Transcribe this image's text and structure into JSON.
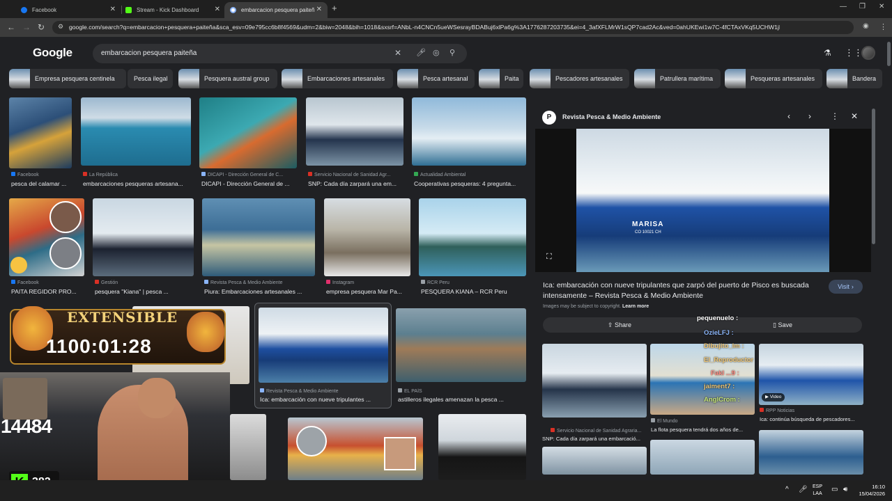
{
  "tabs": [
    {
      "label": "Facebook",
      "color": "#1877f2"
    },
    {
      "label": "Stream - Kick Dashboard",
      "color": "#53fc18"
    },
    {
      "label": "embarcacion pesquera paiteñ",
      "color": "#8ab4f8"
    }
  ],
  "new_tab": "+",
  "url": "google.com/search?q=embarcacion+pesquera+paiteña&sca_esv=09e795cc6b8f4569&udm=2&biw=2048&bih=1018&sxsrf=ANbL-n4CNCn5ueWSesrayBDABuj6xlPa6g%3A1776287203735&ei=4_3afXFLMrW1sQP7cad2Ac&ved=0ahUKEwi1w7C-4fCTAxVKq5UCHW1jB3s...",
  "google": {
    "logo": "Google",
    "query": "embarcacion pesquera paiteña"
  },
  "chips": [
    "Empresa pesquera centinela",
    "Pesca ilegal",
    "Pesquera austral group",
    "Embarcaciones artesanales",
    "Pesca artesanal",
    "Paita",
    "Pescadores artesanales",
    "Patrullera marítima",
    "Pesqueras artesanales",
    "Bandera"
  ],
  "results": {
    "row1": [
      {
        "source": "Facebook",
        "title": "pesca del calamar ...",
        "fav": "#1877f2"
      },
      {
        "source": "La República",
        "title": "embarcaciones pesqueras artesana...",
        "fav": "#d93025"
      },
      {
        "source": "DICAPI - Dirección General de C...",
        "title": "DICAPI - Dirección General de ...",
        "fav": "#8ab4f8"
      },
      {
        "source": "Servicio Nacional de Sanidad Agr...",
        "title": "SNP: Cada día zarpará una em...",
        "fav": "#d93025"
      },
      {
        "source": "Actualidad Ambiental",
        "title": "Cooperativas pesqueras: 4 pregunta...",
        "fav": "#34a853"
      }
    ],
    "row2": [
      {
        "source": "Facebook",
        "title": "PAITA REGIDOR PRO...",
        "fav": "#1877f2"
      },
      {
        "source": "Gestión",
        "title": "pesquera \"Kiana\" | pesca ...",
        "fav": "#d93025"
      },
      {
        "source": "Revista Pesca & Medio Ambiente",
        "title": "Piura: Embarcaciones artesanales ...",
        "fav": "#8ab4f8"
      },
      {
        "source": "Instagram",
        "title": "empresa pesquera Mar Pa...",
        "fav": "#e1306c"
      },
      {
        "source": "RCR Peru",
        "title": "PESQUERA KIANA – RCR Peru",
        "fav": "#9aa0a6"
      }
    ],
    "row3": [
      {
        "source": "Revista Pesca & Medio Ambiente",
        "title": "Ica: embarcación con nueve tripulantes ...",
        "fav": "#8ab4f8"
      },
      {
        "source": "EL PAÍS",
        "title": "astilleros ilegales amenazan la pesca ...",
        "fav": "#9aa0a6"
      }
    ]
  },
  "panel": {
    "site": "Revista Pesca & Medio Ambiente",
    "title": "Ica: embarcación con nueve tripulantes que zarpó del puerto de Pisco es buscada intensamente – Revista Pesca & Medio Ambiente",
    "visit": "Visit",
    "copyright": "Images may be subject to copyright.",
    "learn_more": "Learn more",
    "share": "Share",
    "save": "Save",
    "ship_name": "MARISA",
    "ship_code": "CO 10021 CH",
    "related": [
      {
        "source": "Servicio Nacional de Sanidad Agraria...",
        "title": "SNP: Cada día zarpará una embarcació..."
      },
      {
        "source": "El Mundo",
        "title": "La flota pesquera tendrá dos años de..."
      },
      {
        "source": "RPP Noticias",
        "title": "Ica: continúa búsqueda de pescadores...",
        "badge": "Video"
      }
    ]
  },
  "overlay": {
    "banner": "EXTENSIBLE",
    "timer": "1100:01:28",
    "counter": "14484",
    "kick_viewers": "382",
    "chat": [
      "pequenuelo :",
      "OzieLFJ :",
      "Dibujito_lm :",
      "El_Reproductor",
      "Fakl ...9 :",
      "jaiment7 :",
      "AnglCrom :"
    ]
  },
  "taskbar": {
    "lang1": "ESP",
    "lang2": "LAA",
    "time": "16:10",
    "date": "15/04/2026"
  },
  "colors": {
    "bg": "#202124",
    "accent": "#8ab4f8",
    "kick": "#53fc18"
  }
}
